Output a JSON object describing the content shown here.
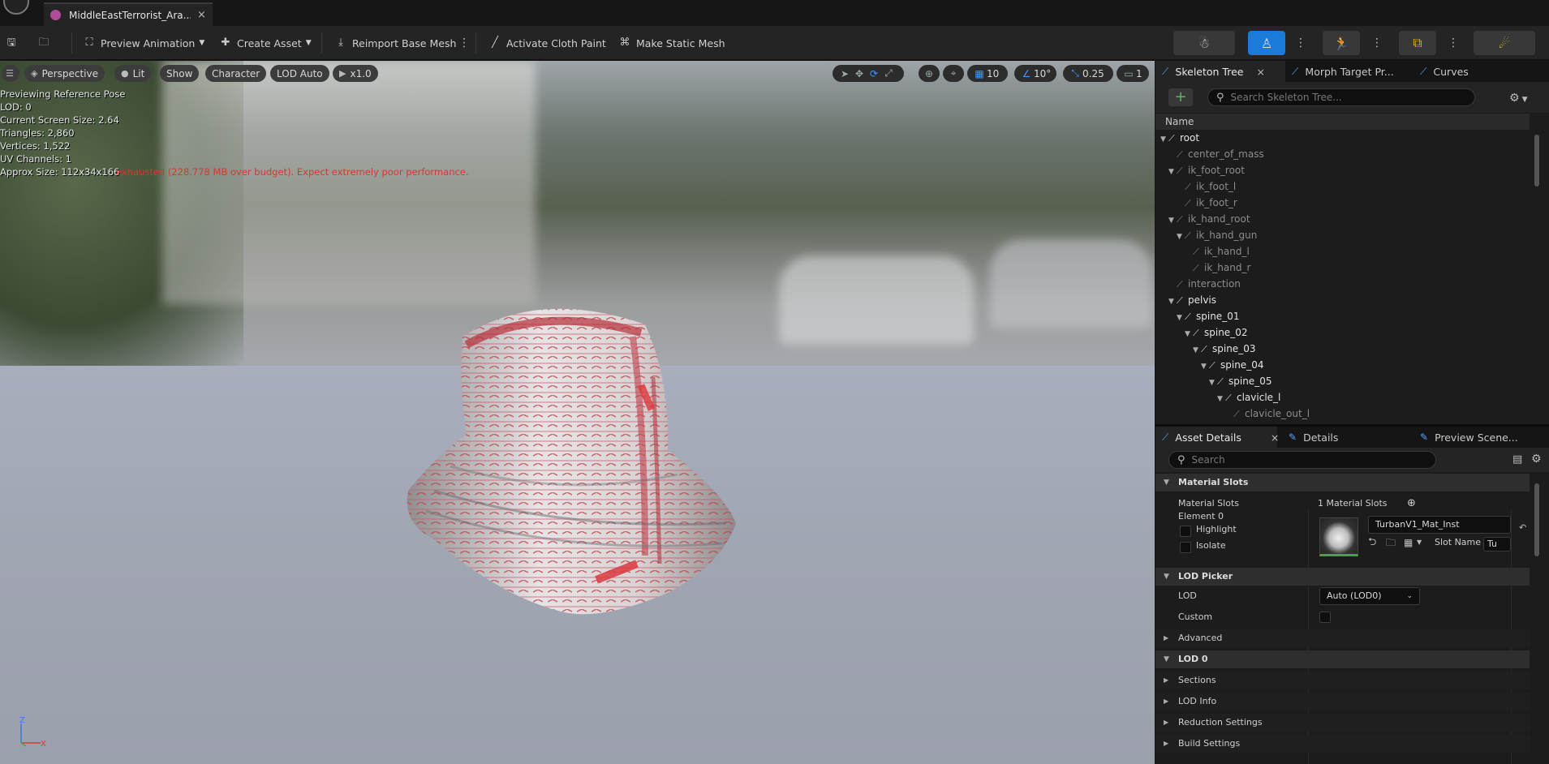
{
  "window": {
    "tab_title": "MiddleEastTerrorist_Ara...",
    "tab_close": "×"
  },
  "toolbar": {
    "preview_animation": "Preview Animation",
    "create_asset": "Create Asset",
    "reimport_base_mesh": "Reimport Base Mesh",
    "activate_cloth_paint": "Activate Cloth Paint",
    "make_static_mesh": "Make Static Mesh"
  },
  "viewport": {
    "pills": {
      "perspective": "Perspective",
      "lit": "Lit",
      "show": "Show",
      "character": "Character",
      "lod": "LOD Auto",
      "speed": "x1.0"
    },
    "grid_snap": "10",
    "rot_snap": "10°",
    "scale_snap": "0.25",
    "camera_speed": "1",
    "stats": [
      "Previewing Reference Pose",
      "LOD: 0",
      "Current Screen Size: 2.64",
      "Triangles: 2,860",
      "Vertices: 1,522",
      "UV Channels: 1",
      "Approx Size: 112x34x166"
    ],
    "warning": "exhausted (228.778 MB over budget). Expect extremely poor performance.",
    "axis": {
      "z": "Z",
      "x": "X"
    }
  },
  "skeleton_panel": {
    "tabs": [
      "Skeleton Tree",
      "Morph Target Pr...",
      "Curves"
    ],
    "tab_close": "×",
    "search_placeholder": "Search Skeleton Tree...",
    "column_name": "Name",
    "bones": [
      {
        "name": "root",
        "depth": 0,
        "expanded": true,
        "bright": true
      },
      {
        "name": "center_of_mass",
        "depth": 1,
        "expanded": false,
        "bright": false
      },
      {
        "name": "ik_foot_root",
        "depth": 1,
        "expanded": true,
        "bright": false
      },
      {
        "name": "ik_foot_l",
        "depth": 2,
        "expanded": false,
        "bright": false
      },
      {
        "name": "ik_foot_r",
        "depth": 2,
        "expanded": false,
        "bright": false
      },
      {
        "name": "ik_hand_root",
        "depth": 1,
        "expanded": true,
        "bright": false
      },
      {
        "name": "ik_hand_gun",
        "depth": 2,
        "expanded": true,
        "bright": false
      },
      {
        "name": "ik_hand_l",
        "depth": 3,
        "expanded": false,
        "bright": false
      },
      {
        "name": "ik_hand_r",
        "depth": 3,
        "expanded": false,
        "bright": false
      },
      {
        "name": "interaction",
        "depth": 1,
        "expanded": false,
        "bright": false
      },
      {
        "name": "pelvis",
        "depth": 1,
        "expanded": true,
        "bright": true
      },
      {
        "name": "spine_01",
        "depth": 2,
        "expanded": true,
        "bright": true
      },
      {
        "name": "spine_02",
        "depth": 3,
        "expanded": true,
        "bright": true
      },
      {
        "name": "spine_03",
        "depth": 4,
        "expanded": true,
        "bright": true
      },
      {
        "name": "spine_04",
        "depth": 5,
        "expanded": true,
        "bright": true
      },
      {
        "name": "spine_05",
        "depth": 6,
        "expanded": true,
        "bright": true
      },
      {
        "name": "clavicle_l",
        "depth": 7,
        "expanded": true,
        "bright": true
      },
      {
        "name": "clavicle_out_l",
        "depth": 8,
        "expanded": false,
        "bright": false
      }
    ]
  },
  "details_panel": {
    "tabs": [
      "Asset Details",
      "Details",
      "Preview Scene..."
    ],
    "tab_close": "×",
    "search_placeholder": "Search",
    "material_slots_category": "Material Slots",
    "material_slots_label": "Material Slots",
    "material_slots_value": "1 Material Slots",
    "element_label": "Element 0",
    "highlight_label": "Highlight",
    "isolate_label": "Isolate",
    "material_name": "TurbanV1_Mat_Inst",
    "slot_name_label": "Slot Name",
    "slot_name_value": "Tu",
    "lod_picker_category": "LOD Picker",
    "lod_label": "LOD",
    "lod_value": "Auto (LOD0)",
    "custom_label": "Custom",
    "advanced_label": "Advanced",
    "lod0_category": "LOD 0",
    "sub_sections": [
      "Sections",
      "LOD Info",
      "Reduction Settings",
      "Build Settings"
    ]
  }
}
